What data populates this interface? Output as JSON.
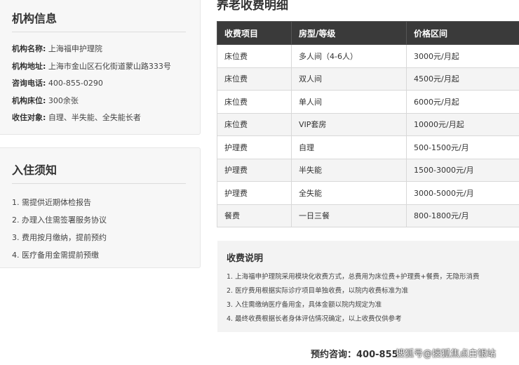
{
  "info": {
    "title": "机构信息",
    "rows": [
      {
        "label": "机构名称:",
        "value": "上海福申护理院"
      },
      {
        "label": "机构地址:",
        "value": "上海市金山区石化街道蒙山路333号"
      },
      {
        "label": "咨询电话:",
        "value": "400-855-0290"
      },
      {
        "label": "机构床位:",
        "value": "300余张"
      },
      {
        "label": "收住对象:",
        "value": "自理、半失能、全失能长者"
      }
    ]
  },
  "notice": {
    "title": "入住须知",
    "items": [
      "1. 需提供近期体检报告",
      "2. 办理入住需签署服务协议",
      "3. 费用按月缴纳，提前预约",
      "4. 医疗备用金需提前预缴"
    ]
  },
  "fees": {
    "heading": "养老收费明细",
    "headers": [
      "收费项目",
      "房型/等级",
      "价格区间"
    ],
    "rows": [
      [
        "床位费",
        "多人间（4-6人）",
        "3000元/月起"
      ],
      [
        "床位费",
        "双人间",
        "4500元/月起"
      ],
      [
        "床位费",
        "单人间",
        "6000元/月起"
      ],
      [
        "床位费",
        "VIP套房",
        "10000元/月起"
      ],
      [
        "护理费",
        "自理",
        "500-1500元/月"
      ],
      [
        "护理费",
        "半失能",
        "1500-3000元/月"
      ],
      [
        "护理费",
        "全失能",
        "3000-5000元/月"
      ],
      [
        "餐费",
        "一日三餐",
        "800-1800元/月"
      ]
    ]
  },
  "notes": {
    "title": "收费说明",
    "items": [
      "1. 上海福申护理院采用模块化收费方式，总费用为床位费+护理费+餐费，无隐形消费",
      "2. 医疗费用根据实际诊疗项目单独收费，以院内收费标准为准",
      "3. 入住需缴纳医疗备用金，具体金额以院内规定为准",
      "4. 最终收费根据长者身体评估情况确定，以上收费仅供参考"
    ]
  },
  "footer": {
    "consult": "预约咨询：400-855",
    "watermark": "搜狐号@搜狐焦点白银站"
  }
}
